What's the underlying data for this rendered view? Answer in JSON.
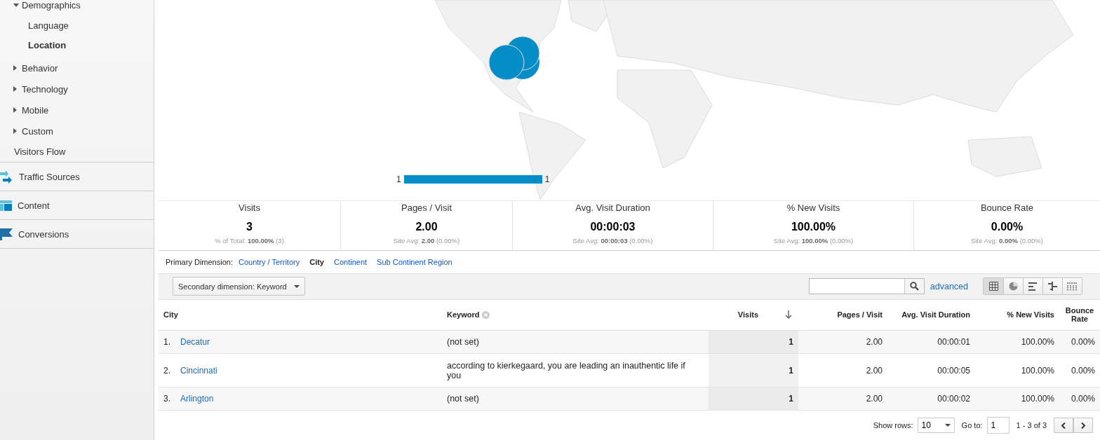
{
  "sidebar": {
    "items": [
      {
        "label": "Demographics",
        "kind": "toggle",
        "expanded": true,
        "children": [
          {
            "label": "Language",
            "selected": false
          },
          {
            "label": "Location",
            "selected": true
          }
        ]
      },
      {
        "label": "Behavior",
        "kind": "toggle",
        "expanded": false
      },
      {
        "label": "Technology",
        "kind": "toggle",
        "expanded": false
      },
      {
        "label": "Mobile",
        "kind": "toggle",
        "expanded": false
      },
      {
        "label": "Custom",
        "kind": "toggle",
        "expanded": false
      },
      {
        "label": "Visitors Flow",
        "kind": "link"
      }
    ],
    "sections": [
      {
        "label": "Traffic Sources",
        "kind": "traffic"
      },
      {
        "label": "Content",
        "kind": "content"
      },
      {
        "label": "Conversions",
        "kind": "conversions"
      }
    ]
  },
  "map": {
    "legend": {
      "min": "1",
      "max": "1"
    }
  },
  "scorecards": [
    {
      "title": "Visits",
      "value": "3",
      "note": "% of Total: **100.00%** (3)"
    },
    {
      "title": "Pages / Visit",
      "value": "2.00",
      "note": "Site Avg: **2.00** (0.00%)"
    },
    {
      "title": "Avg. Visit Duration",
      "value": "00:00:03",
      "note": "Site Avg: **00:00:03** (0.00%)"
    },
    {
      "title": "% New Visits",
      "value": "100.00%",
      "note": "Site Avg: **100.00%** (0.00%)"
    },
    {
      "title": "Bounce Rate",
      "value": "0.00%",
      "note": "Site Avg: **0.00%** (0.00%)"
    }
  ],
  "primary_dimension": {
    "label": "Primary Dimension:",
    "options": [
      {
        "label": "Country / Territory",
        "selected": false
      },
      {
        "label": "City",
        "selected": true
      },
      {
        "label": "Continent",
        "selected": false
      },
      {
        "label": "Sub Continent Region",
        "selected": false
      }
    ]
  },
  "toolbar": {
    "secondary_dimension": "Secondary dimension: Keyword",
    "advanced": "advanced",
    "views": [
      {
        "kind": "table",
        "selected": true
      },
      {
        "kind": "pie",
        "selected": false
      },
      {
        "kind": "bars",
        "selected": false
      },
      {
        "kind": "comparison",
        "selected": false
      },
      {
        "kind": "pivot",
        "selected": false
      }
    ]
  },
  "table": {
    "columns": [
      {
        "label": "City",
        "removable": false,
        "sorted": false
      },
      {
        "label": "Keyword",
        "removable": true,
        "sorted": false
      },
      {
        "label": "Visits",
        "removable": false,
        "sorted": true
      },
      {
        "label": "Pages / Visit",
        "removable": false,
        "sorted": false
      },
      {
        "label": "Avg. Visit Duration",
        "removable": false,
        "sorted": false
      },
      {
        "label": "% New Visits",
        "removable": false,
        "sorted": false
      },
      {
        "label": "Bounce Rate",
        "removable": false,
        "sorted": false
      }
    ],
    "rows": [
      {
        "index": "1.",
        "cells": [
          "Decatur",
          "(not set)",
          "1",
          "2.00",
          "00:00:01",
          "100.00%",
          "0.00%"
        ]
      },
      {
        "index": "2.",
        "cells": [
          "Cincinnati",
          "according to kierkegaard, you are leading an inauthentic life if you",
          "1",
          "2.00",
          "00:00:05",
          "100.00%",
          "0.00%"
        ]
      },
      {
        "index": "3.",
        "cells": [
          "Arlington",
          "(not set)",
          "1",
          "2.00",
          "00:00:02",
          "100.00%",
          "0.00%"
        ]
      }
    ]
  },
  "pagination": {
    "show_rows_label": "Show rows:",
    "show_rows_value": "10",
    "goto_label": "Go to:",
    "goto_value": "1",
    "range": "1 - 3 of 3"
  }
}
